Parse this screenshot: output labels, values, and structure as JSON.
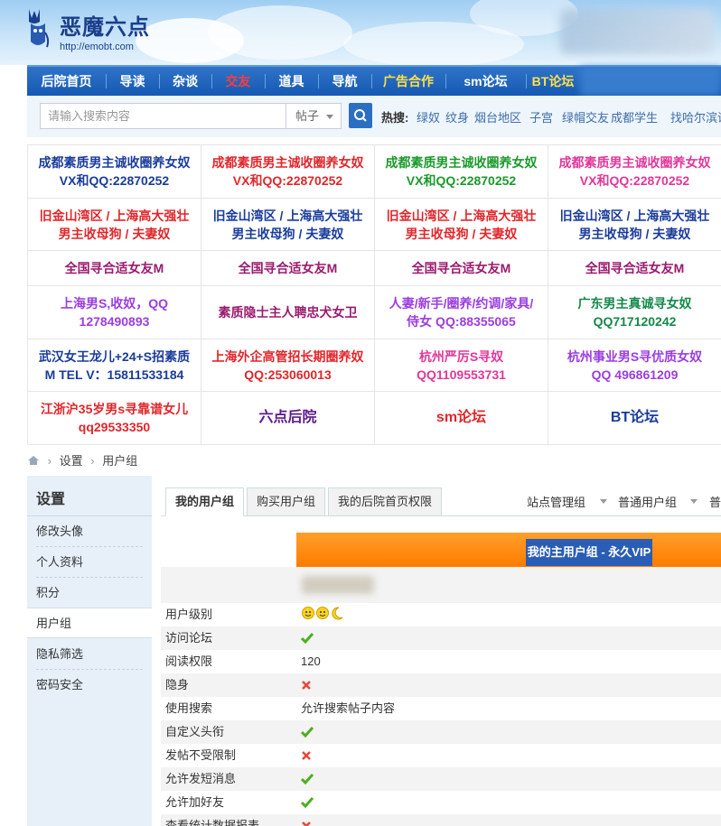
{
  "site": {
    "title": "恶魔六点",
    "url": "http://emobt.com"
  },
  "nav": {
    "items": [
      {
        "label": "后院首页",
        "color": "#ffffff"
      },
      {
        "label": "导读",
        "color": "#ffffff"
      },
      {
        "label": "杂谈",
        "color": "#ffffff"
      },
      {
        "label": "交友",
        "color": "#ff3b3b"
      },
      {
        "label": "道具",
        "color": "#ffffff"
      },
      {
        "label": "导航",
        "color": "#ffffff"
      },
      {
        "label": "广告合作",
        "color": "#ffe14a"
      },
      {
        "label": "sm论坛",
        "color": "#ffffff"
      },
      {
        "label": "BT论坛",
        "color": "#ffe14a"
      }
    ]
  },
  "search": {
    "placeholder": "请输入搜索内容",
    "type_label": "帖子",
    "hot_label": "热搜:",
    "hot_items": [
      "绿奴",
      "纹身",
      "烟台地区",
      "子宫",
      "绿帽交友",
      "成都学生",
      "找哈尔滨调"
    ]
  },
  "ads": [
    {
      "line1": "成都素质男主诚收圈养女奴",
      "line2": "VX和QQ:22870252",
      "color": "#1a3c9b"
    },
    {
      "line1": "成都素质男主诚收圈养女奴",
      "line2": "VX和QQ:22870252",
      "color": "#e0262b"
    },
    {
      "line1": "成都素质男主诚收圈养女奴",
      "line2": "VX和QQ:22870252",
      "color": "#1b9a2c"
    },
    {
      "line1": "成都素质男主诚收圈养女奴",
      "line2": "VX和QQ:22870252",
      "color": "#e0379a"
    },
    {
      "line1": "旧金山湾区 / 上海高大强壮",
      "line2": "男主收母狗 / 夫妻奴",
      "color": "#e0262b"
    },
    {
      "line1": "旧金山湾区 / 上海高大强壮",
      "line2": "男主收母狗 / 夫妻奴",
      "color": "#1a3c9b"
    },
    {
      "line1": "旧金山湾区 / 上海高大强壮",
      "line2": "男主收母狗 / 夫妻奴",
      "color": "#e0262b"
    },
    {
      "line1": "旧金山湾区 / 上海高大强壮",
      "line2": "男主收母狗 / 夫妻奴",
      "color": "#1a3c9b"
    },
    {
      "line1": "全国寻合适女友M",
      "line2": "",
      "color": "#9a1a6e"
    },
    {
      "line1": "全国寻合适女友M",
      "line2": "",
      "color": "#9a1a6e"
    },
    {
      "line1": "全国寻合适女友M",
      "line2": "",
      "color": "#9a1a6e"
    },
    {
      "line1": "全国寻合适女友M",
      "line2": "",
      "color": "#9a1a6e"
    },
    {
      "line1": "上海男S,收奴，QQ",
      "line2": "1278490893",
      "color": "#9b3de0"
    },
    {
      "line1": "素质隐士主人聘忠犬女卫",
      "line2": "",
      "color": "#9a1a6e"
    },
    {
      "line1": "人妻/新手/圈养/约调/家具/",
      "line2": "侍女 QQ:88355065",
      "color": "#9b3de0"
    },
    {
      "line1": "广东男主真诚寻女奴",
      "line2": "QQ717120242",
      "color": "#14884a"
    },
    {
      "line1": "武汉女王龙儿+24+S招素质",
      "line2": "M TEL V：15811533184",
      "color": "#1a3c9b"
    },
    {
      "line1": "上海外企高管招长期圈养奴",
      "line2": "QQ:253060013",
      "color": "#e0262b"
    },
    {
      "line1": "杭州严厉S寻奴",
      "line2": "QQ1109553731",
      "color": "#e0379a"
    },
    {
      "line1": "杭州事业男S寻优质女奴",
      "line2": "QQ 496861209",
      "color": "#9b3de0"
    },
    {
      "line1": "江浙沪35岁男s寻靠谱女儿",
      "line2": "qq29533350",
      "color": "#e0262b"
    },
    {
      "line1": "六点后院",
      "line2": "",
      "color": "#5a1b8c"
    },
    {
      "line1": "sm论坛",
      "line2": "",
      "color": "#e0262b"
    },
    {
      "line1": "BT论坛",
      "line2": "",
      "color": "#1a3c9b"
    }
  ],
  "breadcrumb": {
    "items": [
      "设置",
      "用户组"
    ]
  },
  "sidebar": {
    "title": "设置",
    "items": [
      {
        "label": "修改头像"
      },
      {
        "label": "个人资料"
      },
      {
        "label": "积分"
      },
      {
        "label": "用户组"
      },
      {
        "label": "隐私筛选"
      },
      {
        "label": "密码安全"
      }
    ]
  },
  "tabs": {
    "items": [
      "我的用户组",
      "购买用户组",
      "我的后院首页权限"
    ],
    "right": [
      "站点管理组",
      "普通用户组",
      "普"
    ]
  },
  "group": {
    "title": "我的主用户组 - 永久VIP"
  },
  "permissions": [
    {
      "label": "用户级别",
      "value": "",
      "icon": "level-icons"
    },
    {
      "label": "访问论坛",
      "value": "",
      "icon": "check-icon"
    },
    {
      "label": "阅读权限",
      "value": "120",
      "icon": ""
    },
    {
      "label": "隐身",
      "value": "",
      "icon": "cross-icon"
    },
    {
      "label": "使用搜索",
      "value": "允许搜索帖子内容",
      "icon": ""
    },
    {
      "label": "自定义头衔",
      "value": "",
      "icon": "check-icon"
    },
    {
      "label": "发帖不受限制",
      "value": "",
      "icon": "cross-icon"
    },
    {
      "label": "允许发短消息",
      "value": "",
      "icon": "check-icon"
    },
    {
      "label": "允许加好友",
      "value": "",
      "icon": "check-icon"
    },
    {
      "label": "查看统计数据报表",
      "value": "",
      "icon": "cross-icon"
    }
  ],
  "colors": {
    "nav_bg": "#1559b3",
    "vip_orange": "#ff7b00",
    "vip_blue": "#2a5db5",
    "check_green": "#4caf1e",
    "cross_red": "#e8473b"
  }
}
